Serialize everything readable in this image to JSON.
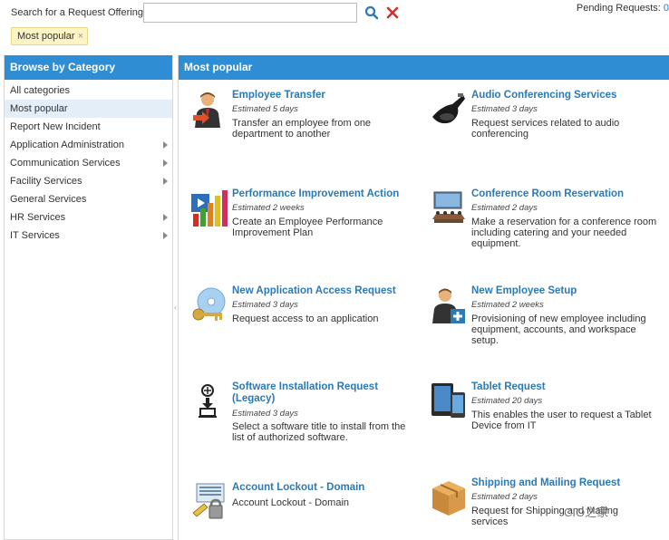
{
  "search": {
    "label": "Search for a Request Offering:",
    "value": "",
    "placeholder": ""
  },
  "pending": {
    "label": "Pending Requests:",
    "count": "0"
  },
  "filter_chip": {
    "label": "Most popular",
    "remove": "×"
  },
  "sidebar": {
    "header": "Browse by Category",
    "items": [
      {
        "label": "All categories"
      },
      {
        "label": "Most popular"
      },
      {
        "label": "Report New Incident"
      },
      {
        "label": "Application Administration"
      },
      {
        "label": "Communication Services"
      },
      {
        "label": "Facility Services"
      },
      {
        "label": "General Services"
      },
      {
        "label": "HR Services"
      },
      {
        "label": "IT Services"
      }
    ]
  },
  "main": {
    "header": "Most popular",
    "cards": [
      {
        "title": "Employee Transfer",
        "estimate": "Estimated 5 days",
        "description": "Transfer an employee from one department to another",
        "icon": "employee-transfer-icon"
      },
      {
        "title": "Audio Conferencing Services",
        "estimate": "Estimated 3 days",
        "description": "Request services related to audio conferencing",
        "icon": "conference-phone-icon"
      },
      {
        "title": "Performance Improvement Action",
        "estimate": "Estimated 2 weeks",
        "description": "Create an Employee Performance Improvement Plan",
        "icon": "performance-chart-icon"
      },
      {
        "title": "Conference Room Reservation",
        "estimate": "Estimated 2 days",
        "description": "Make a reservation for a conference room including catering and your needed equipment.",
        "icon": "conference-room-icon"
      },
      {
        "title": "New Application Access Request",
        "estimate": "Estimated 3 days",
        "description": "Request access to an application",
        "icon": "cd-key-icon"
      },
      {
        "title": "New Employee Setup",
        "estimate": "Estimated 2 weeks",
        "description": "Provisioning of new employee including equipment, accounts, and workspace setup.",
        "icon": "new-employee-icon"
      },
      {
        "title": "Software Installation Request (Legacy)",
        "estimate": "Estimated 3 days",
        "description": "Select a software title to install from the list of authorized software.",
        "icon": "software-install-icon"
      },
      {
        "title": "Tablet Request",
        "estimate": "Estimated 20 days",
        "description": "This enables the user to request a Tablet Device from IT",
        "icon": "tablet-icon"
      },
      {
        "title": "Account Lockout - Domain",
        "estimate": "",
        "description": "Account Lockout - Domain",
        "icon": "account-lockout-icon"
      },
      {
        "title": "Shipping and Mailing Request",
        "estimate": "Estimated 2 days",
        "description": "Request for Shipping and Mailing services",
        "icon": "shipping-box-icon"
      }
    ]
  },
  "watermark": "CIO之家",
  "colors": {
    "accent": "#2f8dd3",
    "link": "#2a7ab8",
    "chip_bg": "#fdf4c6",
    "clear": "#d0302a"
  }
}
